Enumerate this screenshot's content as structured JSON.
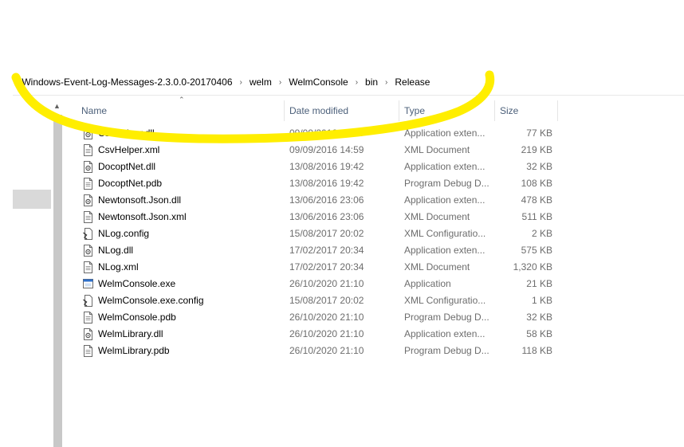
{
  "breadcrumb": {
    "items": [
      "Windows-Event-Log-Messages-2.3.0.0-20170406",
      "welm",
      "WelmConsole",
      "bin",
      "Release"
    ]
  },
  "columns": {
    "name": "Name",
    "date": "Date modified",
    "type": "Type",
    "size": "Size"
  },
  "files": [
    {
      "name": "CsvHelper.dll",
      "date": "09/09/2016 14:59",
      "type": "Application exten...",
      "size": "77 KB",
      "icon": "dll-file-icon"
    },
    {
      "name": "CsvHelper.xml",
      "date": "09/09/2016 14:59",
      "type": "XML Document",
      "size": "219 KB",
      "icon": "document-file-icon"
    },
    {
      "name": "DocoptNet.dll",
      "date": "13/08/2016 19:42",
      "type": "Application exten...",
      "size": "32 KB",
      "icon": "dll-file-icon"
    },
    {
      "name": "DocoptNet.pdb",
      "date": "13/08/2016 19:42",
      "type": "Program Debug D...",
      "size": "108 KB",
      "icon": "document-file-icon"
    },
    {
      "name": "Newtonsoft.Json.dll",
      "date": "13/06/2016 23:06",
      "type": "Application exten...",
      "size": "478 KB",
      "icon": "dll-file-icon"
    },
    {
      "name": "Newtonsoft.Json.xml",
      "date": "13/06/2016 23:06",
      "type": "XML Document",
      "size": "511 KB",
      "icon": "document-file-icon"
    },
    {
      "name": "NLog.config",
      "date": "15/08/2017 20:02",
      "type": "XML Configuratio...",
      "size": "2 KB",
      "icon": "config-file-icon"
    },
    {
      "name": "NLog.dll",
      "date": "17/02/2017 20:34",
      "type": "Application exten...",
      "size": "575 KB",
      "icon": "dll-file-icon"
    },
    {
      "name": "NLog.xml",
      "date": "17/02/2017 20:34",
      "type": "XML Document",
      "size": "1,320 KB",
      "icon": "document-file-icon"
    },
    {
      "name": "WelmConsole.exe",
      "date": "26/10/2020 21:10",
      "type": "Application",
      "size": "21 KB",
      "icon": "exe-file-icon"
    },
    {
      "name": "WelmConsole.exe.config",
      "date": "15/08/2017 20:02",
      "type": "XML Configuratio...",
      "size": "1 KB",
      "icon": "config-file-icon"
    },
    {
      "name": "WelmConsole.pdb",
      "date": "26/10/2020 21:10",
      "type": "Program Debug D...",
      "size": "32 KB",
      "icon": "document-file-icon"
    },
    {
      "name": "WelmLibrary.dll",
      "date": "26/10/2020 21:10",
      "type": "Application exten...",
      "size": "58 KB",
      "icon": "dll-file-icon"
    },
    {
      "name": "WelmLibrary.pdb",
      "date": "26/10/2020 21:10",
      "type": "Program Debug D...",
      "size": "118 KB",
      "icon": "document-file-icon"
    }
  ],
  "colors": {
    "highlight": "#ffee00",
    "header_text": "#4c607a",
    "secondary_text": "#6d6d6d"
  }
}
